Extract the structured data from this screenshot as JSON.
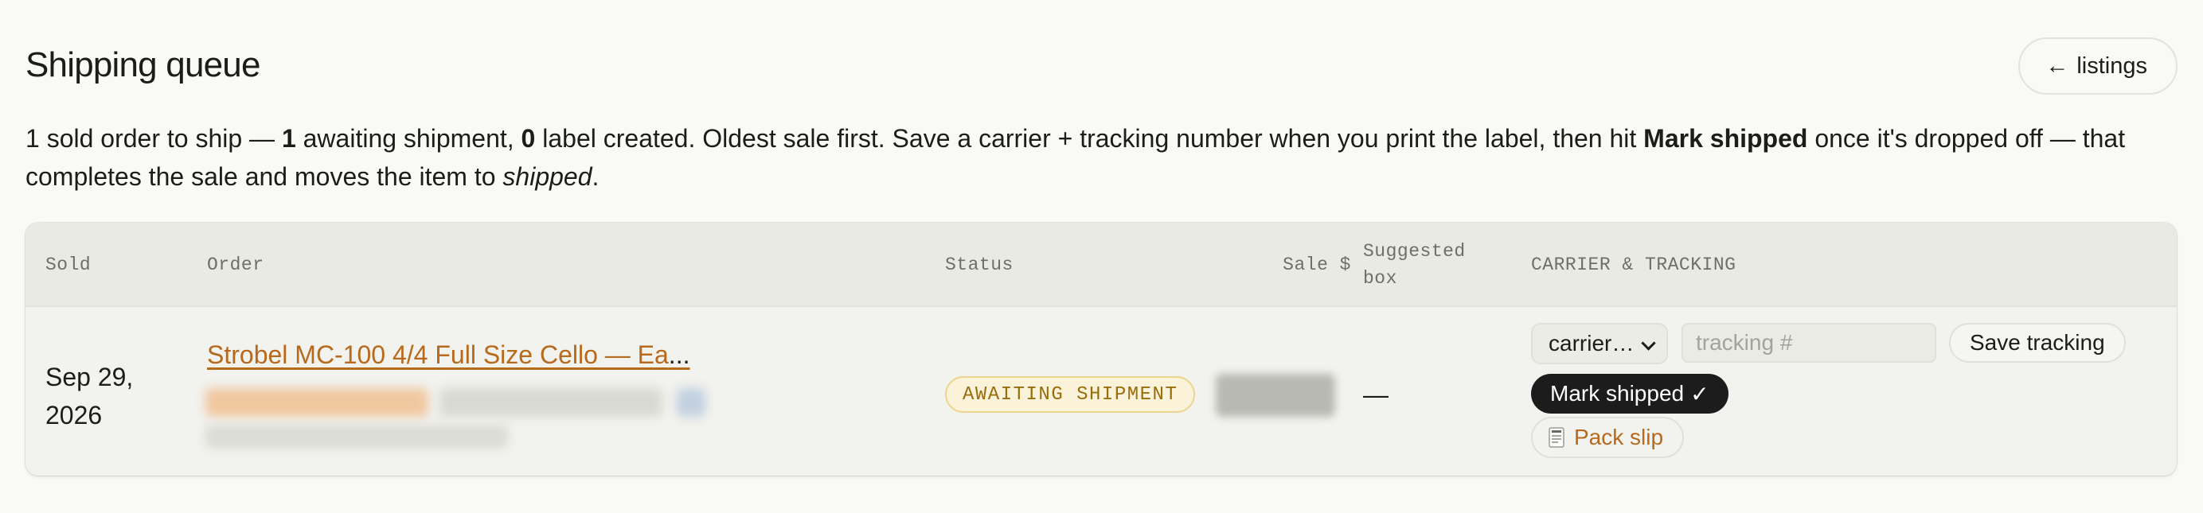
{
  "header": {
    "title": "Shipping queue",
    "back_button": {
      "arrow": "←",
      "label": "listings"
    }
  },
  "intro": {
    "p1": "1 sold order to ship — ",
    "awaiting_count": "1",
    "p2": " awaiting shipment, ",
    "label_count": "0",
    "p3": " label created. Oldest sale first. Save a carrier + tracking number when you print the label, then hit ",
    "mark_shipped": "Mark shipped",
    "p4": " once it's dropped off — that completes the sale and moves the item to ",
    "shipped": "shipped",
    "p5": "."
  },
  "table": {
    "columns": {
      "sold": "Sold",
      "order": "Order",
      "status": "Status",
      "sale": "Sale $",
      "box": "Suggested box",
      "carrier": "CARRIER & TRACKING"
    },
    "rows": [
      {
        "sold_date": "Sep 29, 2026",
        "order_title": "Strobel MC-100 4/4 Full Size Cello — Ea",
        "order_ellipsis": "...",
        "status": "AWAITING SHIPMENT",
        "suggested_box": "—",
        "carrier_select": "carrier…",
        "tracking_placeholder": "tracking #",
        "save_tracking": "Save tracking",
        "mark_shipped": "Mark shipped",
        "mark_shipped_check": "✓",
        "pack_slip": "Pack slip"
      }
    ]
  },
  "colors": {
    "accent_link": "#b86a1c",
    "badge_text": "#9a6d0c",
    "badge_bg": "#faf3da",
    "primary_button": "#1c1c1c",
    "page_bg": "#f9f9f7"
  },
  "icons": {
    "back": "arrow-left-icon",
    "carrier_select": "chevron-down-icon",
    "pack_slip": "receipt-icon"
  }
}
